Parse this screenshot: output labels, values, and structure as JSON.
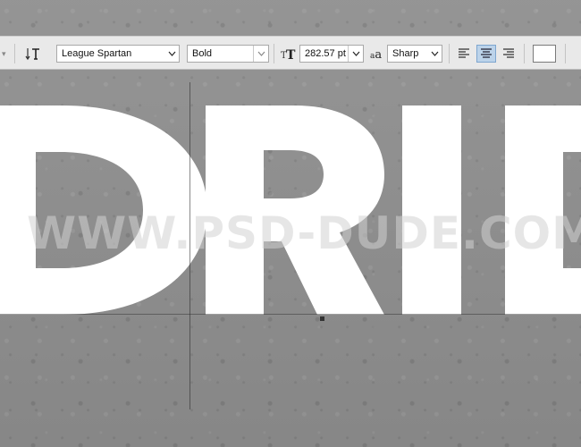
{
  "options_bar": {
    "font_family": "League Spartan",
    "font_style": "Bold",
    "font_size": "282.57 pt",
    "anti_alias": "Sharp",
    "anti_alias_icon_text": "a",
    "anti_alias_icon_text2": "a",
    "align_active": "center",
    "text_color": "#ffffff"
  },
  "canvas": {
    "text_layer": "DRIP",
    "watermark": "WWW.PSD-DUDE.COM",
    "text_color": "#ffffff"
  }
}
